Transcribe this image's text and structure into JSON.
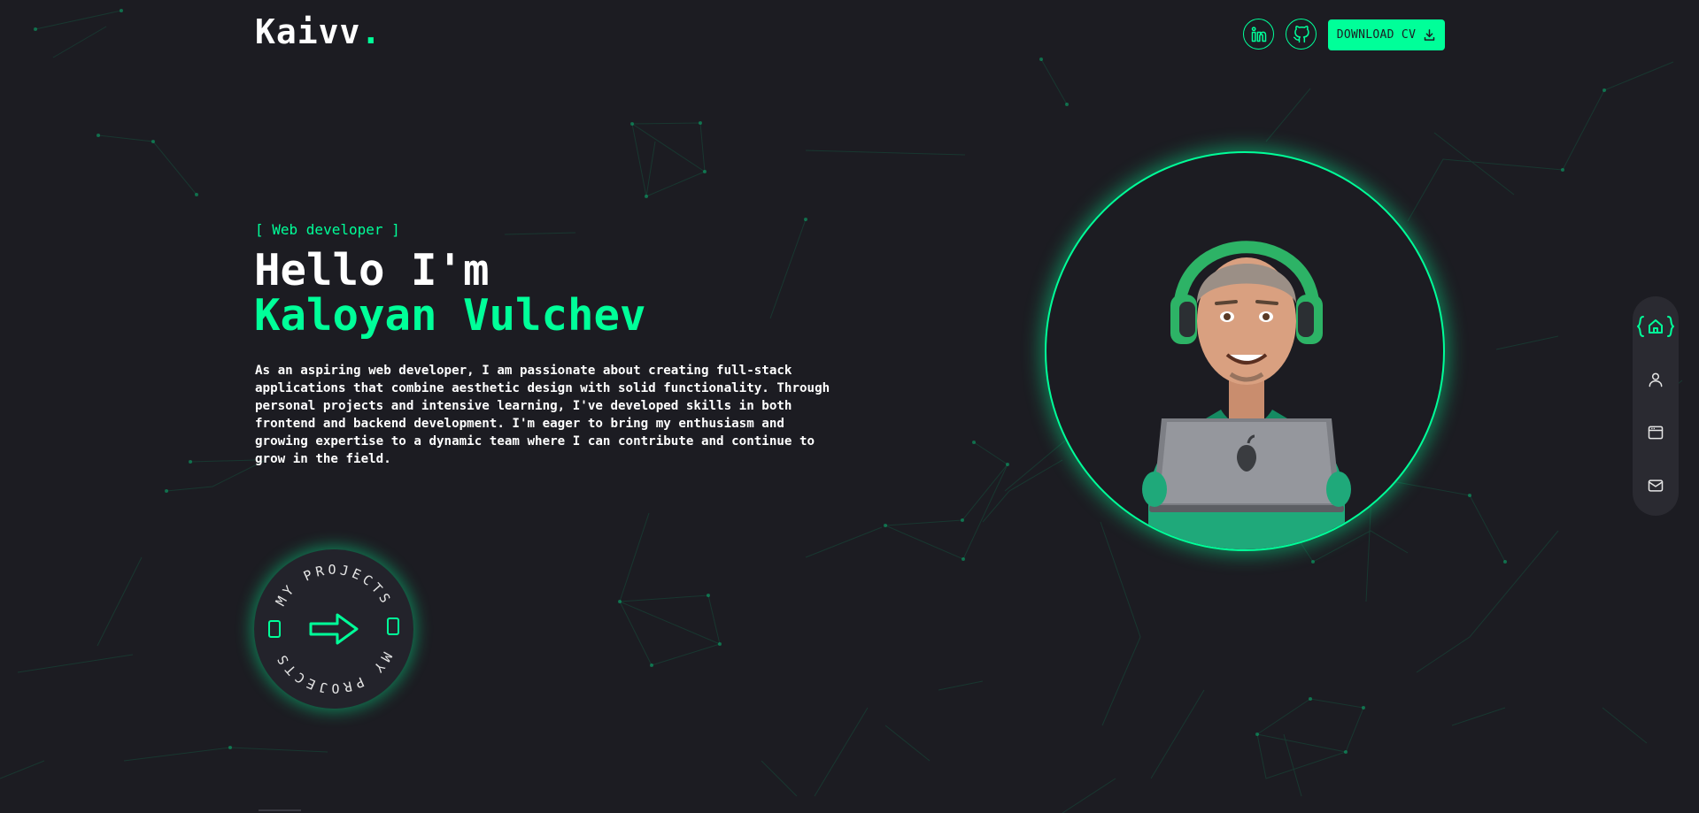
{
  "header": {
    "logo_text": "Kaivv",
    "logo_dot": ".",
    "social": [
      {
        "icon": "linkedin-icon"
      },
      {
        "icon": "github-icon"
      }
    ],
    "download_label": "DOWNLOAD CV",
    "download_icon": "download-icon"
  },
  "hero": {
    "role_tag": "[ Web developer ]",
    "greeting": "Hello I'm",
    "name": "Kaloyan Vulchev",
    "bio": "As an aspiring web developer, I am passionate about creating full-stack applications that combine aesthetic design with solid functionality. Through personal projects and intensive learning, I've developed skills in both frontend and backend development. I'm eager to bring my enthusiasm and growing expertise to a dynamic team where I can contribute and continue to grow in the field.",
    "portrait": "avatar-developer-with-headphones-and-laptop"
  },
  "projects_badge": {
    "text_top": "MY PROJECTS",
    "text_bottom": "MY PROJECTS",
    "icon": "arrow-right-icon"
  },
  "side_nav": {
    "items": [
      {
        "name": "home",
        "icon": "home-icon",
        "active": true
      },
      {
        "name": "about",
        "icon": "user-icon",
        "active": false
      },
      {
        "name": "projects",
        "icon": "browser-window-icon",
        "active": false
      },
      {
        "name": "contact",
        "icon": "mail-icon",
        "active": false
      }
    ]
  },
  "colors": {
    "accent": "#00ff99",
    "background": "#1c1c22",
    "nav_background": "#2a2a31",
    "text": "#ffffff"
  }
}
